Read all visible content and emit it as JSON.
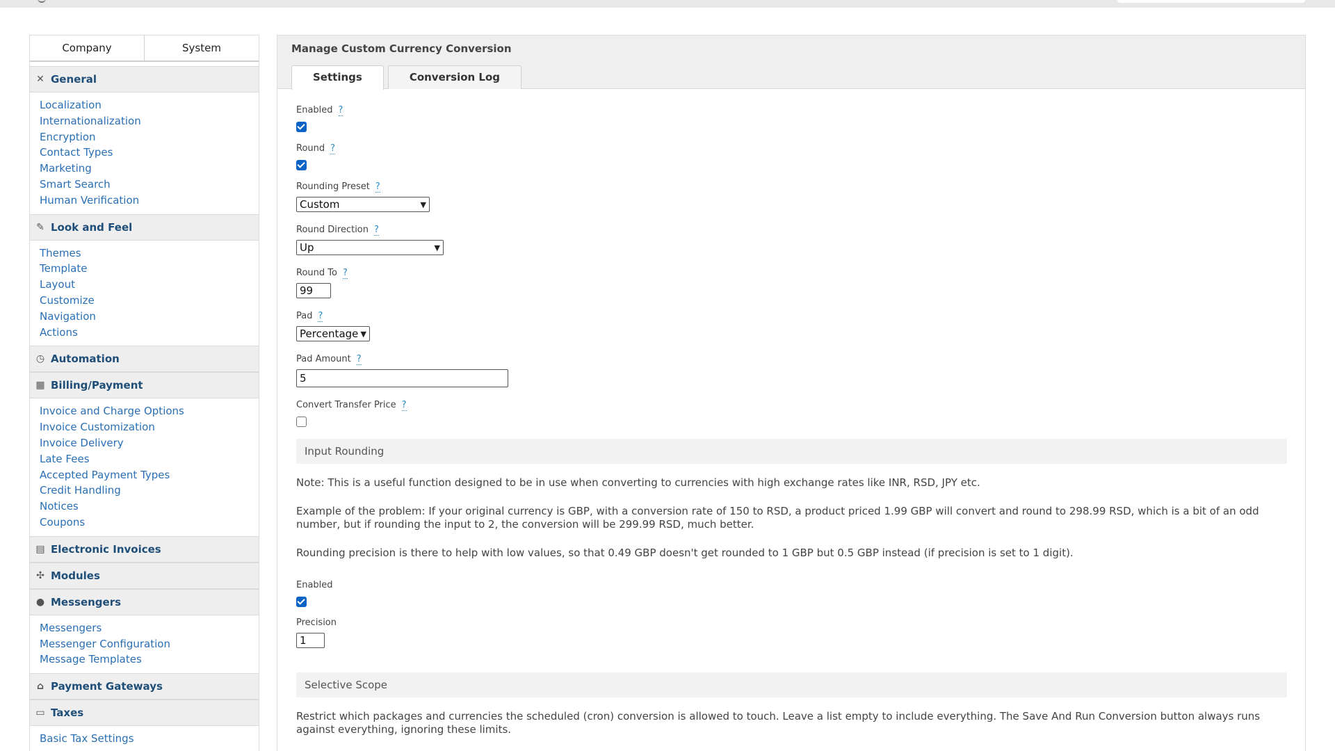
{
  "sidebar": {
    "tabs": [
      "Company",
      "System"
    ],
    "sections": [
      {
        "title": "General",
        "icon": "wrench-screwdriver-icon",
        "links": [
          "Localization",
          "Internationalization",
          "Encryption",
          "Contact Types",
          "Marketing",
          "Smart Search",
          "Human Verification"
        ]
      },
      {
        "title": "Look and Feel",
        "icon": "brush-icon",
        "links": [
          "Themes",
          "Template",
          "Layout",
          "Customize",
          "Navigation",
          "Actions"
        ]
      },
      {
        "title": "Automation",
        "icon": "clock-icon",
        "links": []
      },
      {
        "title": "Billing/Payment",
        "icon": "calculator-icon",
        "links": [
          "Invoice and Charge Options",
          "Invoice Customization",
          "Invoice Delivery",
          "Late Fees",
          "Accepted Payment Types",
          "Credit Handling",
          "Notices",
          "Coupons"
        ]
      },
      {
        "title": "Electronic Invoices",
        "icon": "document-icon",
        "links": []
      },
      {
        "title": "Modules",
        "icon": "puzzle-icon",
        "links": []
      },
      {
        "title": "Messengers",
        "icon": "chat-bubble-icon",
        "links": [
          "Messengers",
          "Messenger Configuration",
          "Message Templates"
        ]
      },
      {
        "title": "Payment Gateways",
        "icon": "bank-icon",
        "links": []
      },
      {
        "title": "Taxes",
        "icon": "money-icon",
        "links": [
          "Basic Tax Settings"
        ]
      }
    ]
  },
  "main": {
    "title": "Manage Custom Currency Conversion",
    "tabs": [
      "Settings",
      "Conversion Log"
    ],
    "help_glyph": "?",
    "fields": {
      "enabled_label": "Enabled",
      "round_label": "Round",
      "rounding_preset_label": "Rounding Preset",
      "rounding_preset_value": "Custom",
      "round_direction_label": "Round Direction",
      "round_direction_value": "Up",
      "round_to_label": "Round To",
      "round_to_value": "99",
      "pad_label": "Pad",
      "pad_value": "Percentage",
      "pad_amount_label": "Pad Amount",
      "pad_amount_value": "5",
      "convert_transfer_label": "Convert Transfer Price"
    },
    "input_rounding": {
      "heading": "Input Rounding",
      "note": "Note: This is a useful function designed to be in use when converting to currencies with high exchange rates like INR, RSD, JPY etc.",
      "example": "Example of the problem: If your original currency is GBP, with a conversion rate of 150 to RSD, a product priced 1.99 GBP will convert and round to 298.99 RSD, which is a bit of an odd number, but if rounding the input to 2, the conversion will be 299.99 RSD, much better.",
      "precision_note": "Rounding precision is there to help with low values, so that 0.49 GBP doesn't get rounded to 1 GBP but 0.5 GBP instead (if precision is set to 1 digit).",
      "enabled_label": "Enabled",
      "precision_label": "Precision",
      "precision_value": "1"
    },
    "selective_scope": {
      "heading": "Selective Scope",
      "text": "Restrict which packages and currencies the scheduled (cron) conversion is allowed to touch. Leave a list empty to include everything. The Save And Run Conversion button always runs against everything, ignoring these limits."
    }
  }
}
